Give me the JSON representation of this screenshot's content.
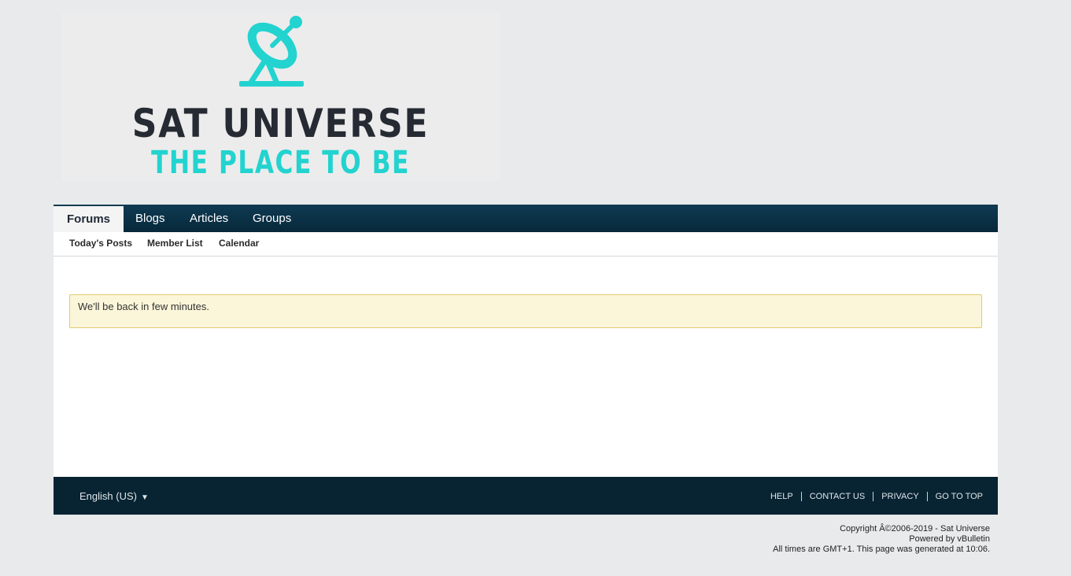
{
  "header": {
    "logo_title": "SAT UNIVERSE",
    "logo_tagline": "THE PLACE TO BE"
  },
  "nav": {
    "tabs": [
      {
        "label": "Forums",
        "active": true
      },
      {
        "label": "Blogs"
      },
      {
        "label": "Articles"
      },
      {
        "label": "Groups"
      }
    ],
    "subnav": [
      "Today's Posts",
      "Member List",
      "Calendar"
    ]
  },
  "notice": {
    "message": "We'll be back in few minutes."
  },
  "footer": {
    "language": "English (US)",
    "links": [
      "HELP",
      "CONTACT US",
      "PRIVACY",
      "GO TO TOP"
    ],
    "copyright": "Copyright Â©2006-2019 - Sat Universe",
    "powered_by": "Powered by vBulletin",
    "times": "All times are GMT+1. This page was generated at 10:06."
  },
  "colors": {
    "accent_teal": "#22d3cf",
    "nav_bg": "#0f3b53",
    "footer_bg": "#082433"
  }
}
